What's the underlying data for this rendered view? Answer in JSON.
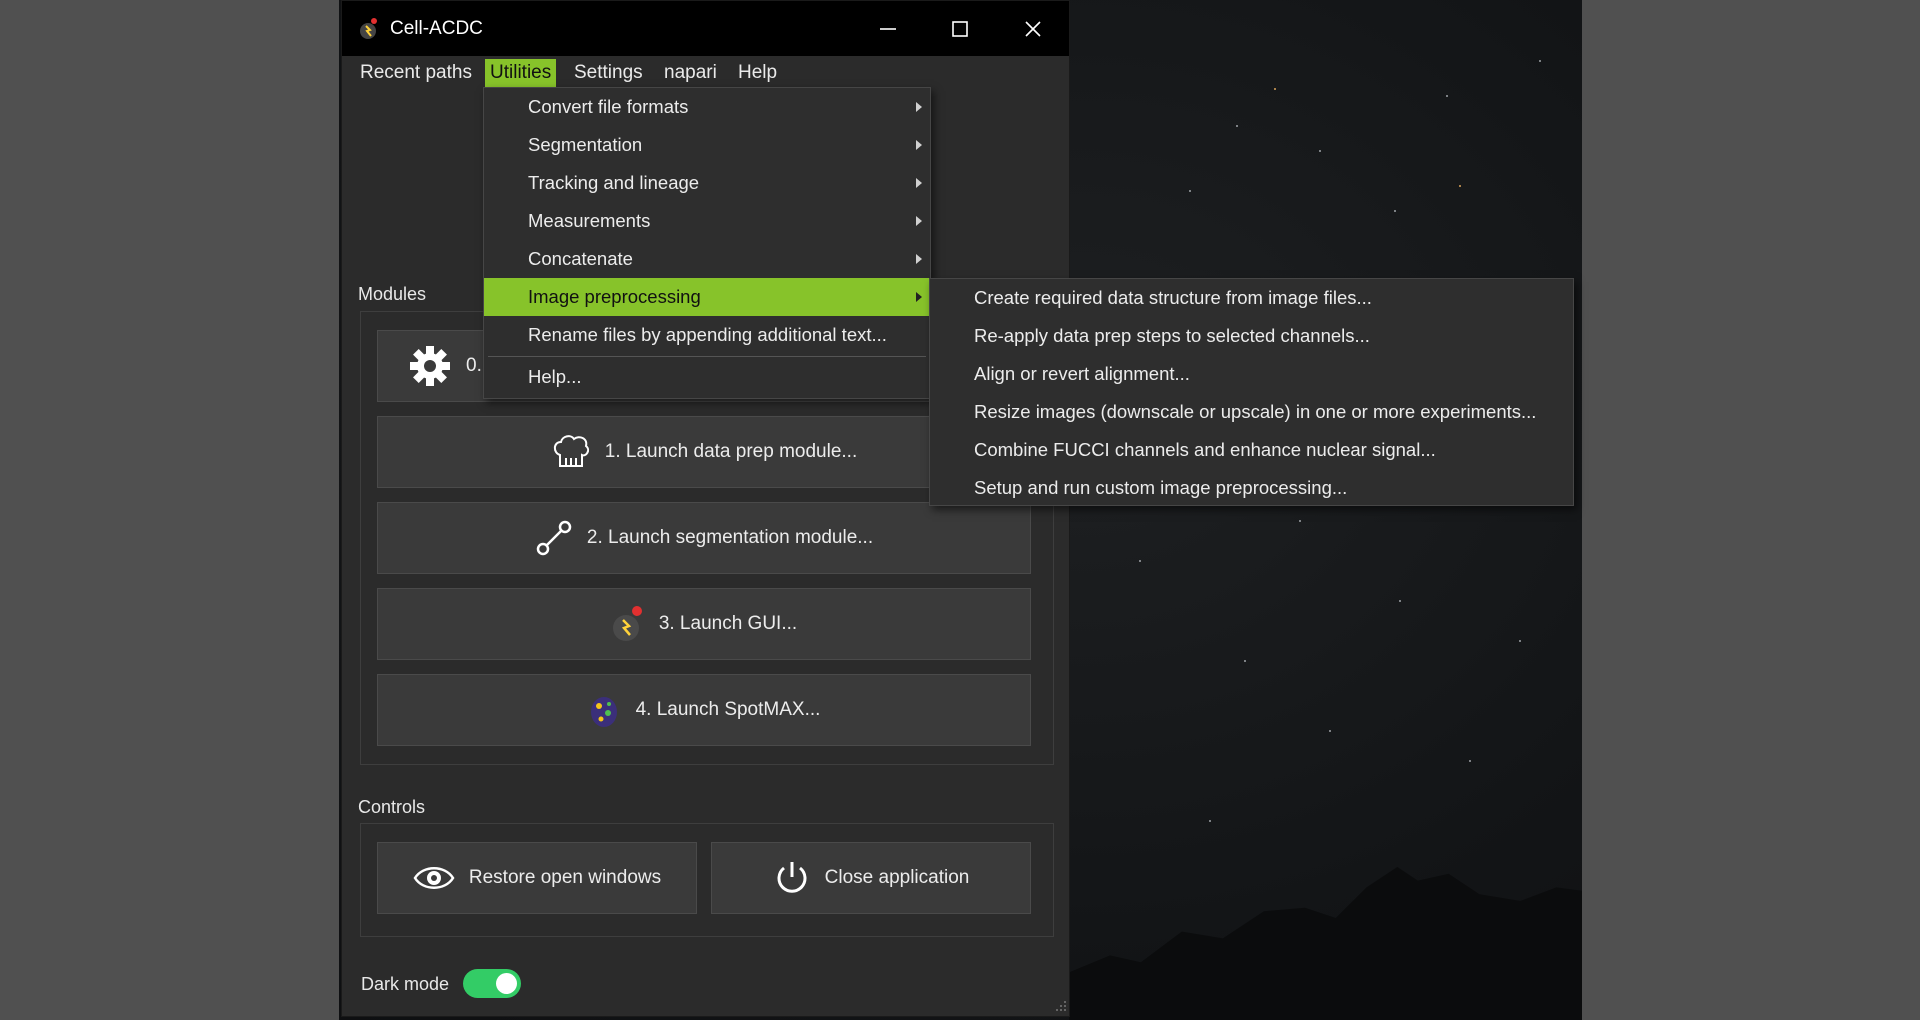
{
  "window": {
    "title": "Cell-ACDC"
  },
  "menubar": {
    "items": [
      {
        "label": "Recent paths"
      },
      {
        "label": "Utilities"
      },
      {
        "label": "Settings"
      },
      {
        "label": "napari"
      },
      {
        "label": "Help"
      }
    ]
  },
  "utilities_menu": {
    "items": [
      {
        "label": "Convert file formats",
        "submenu": true
      },
      {
        "label": "Segmentation",
        "submenu": true
      },
      {
        "label": "Tracking and lineage",
        "submenu": true
      },
      {
        "label": "Measurements",
        "submenu": true
      },
      {
        "label": "Concatenate",
        "submenu": true
      },
      {
        "label": "Image preprocessing",
        "submenu": true
      },
      {
        "label": "Rename files by appending additional text..."
      },
      {
        "label": "Help..."
      }
    ]
  },
  "preprocessing_submenu": {
    "items": [
      {
        "label": "Create required data structure from image files..."
      },
      {
        "label": "Re-apply data prep steps to selected channels..."
      },
      {
        "label": "Align or revert alignment..."
      },
      {
        "label": "Resize images (downscale or upscale) in one or more experiments..."
      },
      {
        "label": "Combine FUCCI channels and enhance nuclear signal..."
      },
      {
        "label": "Setup and run custom image preprocessing..."
      }
    ]
  },
  "modules": {
    "label": "Modules",
    "buttons": [
      {
        "label": "0.",
        "icon": "gear-icon"
      },
      {
        "label": "1. Launch data prep module...",
        "icon": "chef-hat-icon"
      },
      {
        "label": "2. Launch segmentation module...",
        "icon": "segmentation-icon"
      },
      {
        "label": "3. Launch GUI...",
        "icon": "cell-acdc-icon"
      },
      {
        "label": "4. Launch SpotMAX...",
        "icon": "spotmax-icon"
      }
    ]
  },
  "controls": {
    "label": "Controls",
    "restore_label": "Restore open windows",
    "close_label": "Close application"
  },
  "dark_mode": {
    "label": "Dark mode",
    "enabled": true
  },
  "colors": {
    "accent": "#87c32a",
    "toggle_on": "#33cc66",
    "window_bg": "#2b2b2b"
  }
}
